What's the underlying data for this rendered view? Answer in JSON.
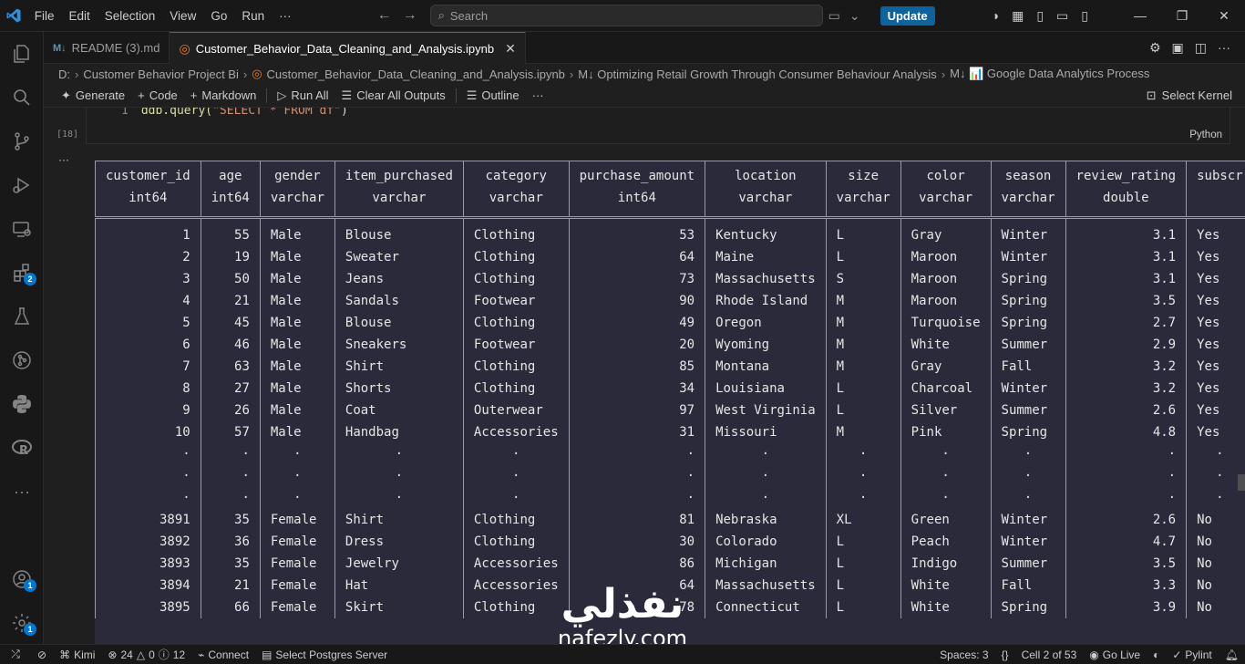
{
  "menu": [
    "File",
    "Edit",
    "Selection",
    "View",
    "Go",
    "Run",
    "···"
  ],
  "search": {
    "placeholder": "Search"
  },
  "update_label": "Update",
  "tabs": [
    {
      "label": "README (3).md",
      "icon": "markdown-icon",
      "active": false
    },
    {
      "label": "Customer_Behavior_Data_Cleaning_and_Analysis.ipynb",
      "icon": "jupyter-icon",
      "active": true
    }
  ],
  "breadcrumb": [
    "D:",
    "Customer Behavior Project Bi",
    "Customer_Behavior_Data_Cleaning_and_Analysis.ipynb",
    "M↓ Optimizing Retail Growth Through Consumer Behaviour Analysis",
    "M↓ 📊 Google Data Analytics Process"
  ],
  "toolbar": {
    "generate": "Generate",
    "code": "Code",
    "markdown": "Markdown",
    "run_all": "Run All",
    "clear_outputs": "Clear All Outputs",
    "outline": "Outline",
    "more": "···",
    "kernel": "Select Kernel"
  },
  "cell": {
    "line_number": "1",
    "code_fn": "ddb.query(",
    "code_str": "\"SELECT * FROM df\"",
    "code_end": ")",
    "exec_count": "[18]",
    "language": "Python",
    "output_dots": "···"
  },
  "table": {
    "columns": [
      {
        "name": "customer_id",
        "type": "int64",
        "align": "num",
        "width": 114
      },
      {
        "name": "age",
        "type": "int64",
        "align": "num",
        "width": 66
      },
      {
        "name": "gender",
        "type": "varchar",
        "align": "txt",
        "width": 82
      },
      {
        "name": "item_purchased",
        "type": "varchar",
        "align": "txt",
        "width": 139
      },
      {
        "name": "category",
        "type": "varchar",
        "align": "txt",
        "width": 115
      },
      {
        "name": "purchase_amount",
        "type": "int64",
        "align": "num",
        "width": 148
      },
      {
        "name": "location",
        "type": "varchar",
        "align": "txt",
        "width": 131
      },
      {
        "name": "size",
        "type": "varchar",
        "align": "txt",
        "width": 82
      },
      {
        "name": "color",
        "type": "varchar",
        "align": "txt",
        "width": 98
      },
      {
        "name": "season",
        "type": "varchar",
        "align": "txt",
        "width": 83
      },
      {
        "name": "review_rating",
        "type": "double",
        "align": "num",
        "width": 131
      },
      {
        "name": "subscr",
        "type": "",
        "align": "txt",
        "width": 70
      }
    ],
    "rows_top": [
      [
        "1",
        "55",
        "Male",
        "Blouse",
        "Clothing",
        "53",
        "Kentucky",
        "L",
        "Gray",
        "Winter",
        "3.1",
        "Yes"
      ],
      [
        "2",
        "19",
        "Male",
        "Sweater",
        "Clothing",
        "64",
        "Maine",
        "L",
        "Maroon",
        "Winter",
        "3.1",
        "Yes"
      ],
      [
        "3",
        "50",
        "Male",
        "Jeans",
        "Clothing",
        "73",
        "Massachusetts",
        "S",
        "Maroon",
        "Spring",
        "3.1",
        "Yes"
      ],
      [
        "4",
        "21",
        "Male",
        "Sandals",
        "Footwear",
        "90",
        "Rhode Island",
        "M",
        "Maroon",
        "Spring",
        "3.5",
        "Yes"
      ],
      [
        "5",
        "45",
        "Male",
        "Blouse",
        "Clothing",
        "49",
        "Oregon",
        "M",
        "Turquoise",
        "Spring",
        "2.7",
        "Yes"
      ],
      [
        "6",
        "46",
        "Male",
        "Sneakers",
        "Footwear",
        "20",
        "Wyoming",
        "M",
        "White",
        "Summer",
        "2.9",
        "Yes"
      ],
      [
        "7",
        "63",
        "Male",
        "Shirt",
        "Clothing",
        "85",
        "Montana",
        "M",
        "Gray",
        "Fall",
        "3.2",
        "Yes"
      ],
      [
        "8",
        "27",
        "Male",
        "Shorts",
        "Clothing",
        "34",
        "Louisiana",
        "L",
        "Charcoal",
        "Winter",
        "3.2",
        "Yes"
      ],
      [
        "9",
        "26",
        "Male",
        "Coat",
        "Outerwear",
        "97",
        "West Virginia",
        "L",
        "Silver",
        "Summer",
        "2.6",
        "Yes"
      ],
      [
        "10",
        "57",
        "Male",
        "Handbag",
        "Accessories",
        "31",
        "Missouri",
        "M",
        "Pink",
        "Spring",
        "4.8",
        "Yes"
      ]
    ],
    "ellipsis_rows": 3,
    "rows_bottom": [
      [
        "3891",
        "35",
        "Female",
        "Shirt",
        "Clothing",
        "81",
        "Nebraska",
        "XL",
        "Green",
        "Winter",
        "2.6",
        "No"
      ],
      [
        "3892",
        "36",
        "Female",
        "Dress",
        "Clothing",
        "30",
        "Colorado",
        "L",
        "Peach",
        "Winter",
        "4.7",
        "No"
      ],
      [
        "3893",
        "35",
        "Female",
        "Jewelry",
        "Accessories",
        "86",
        "Michigan",
        "L",
        "Indigo",
        "Summer",
        "3.5",
        "No"
      ],
      [
        "3894",
        "21",
        "Female",
        "Hat",
        "Accessories",
        "64",
        "Massachusetts",
        "L",
        "White",
        "Fall",
        "3.3",
        "No"
      ],
      [
        "3895",
        "66",
        "Female",
        "Skirt",
        "Clothing",
        "78",
        "Connecticut",
        "L",
        "White",
        "Spring",
        "3.9",
        "No"
      ]
    ]
  },
  "status": {
    "kimi": "Kimi",
    "errors": "24",
    "warnings": "0",
    "infos": "12",
    "connect": "Connect",
    "postgres": "Select Postgres Server",
    "spaces": "Spaces: 3",
    "cell": "Cell 2 of 53",
    "golive": "Go Live",
    "pylint": "Pylint"
  },
  "badges": {
    "extensions": "2",
    "accounts": "1",
    "settings": "1"
  },
  "watermark": {
    "arabic": "نفذلي",
    "latin": "nafezly.com"
  },
  "colors": {
    "accent": "#0078d4",
    "update": "#0e639c",
    "output_bg": "#2a2a3a"
  }
}
